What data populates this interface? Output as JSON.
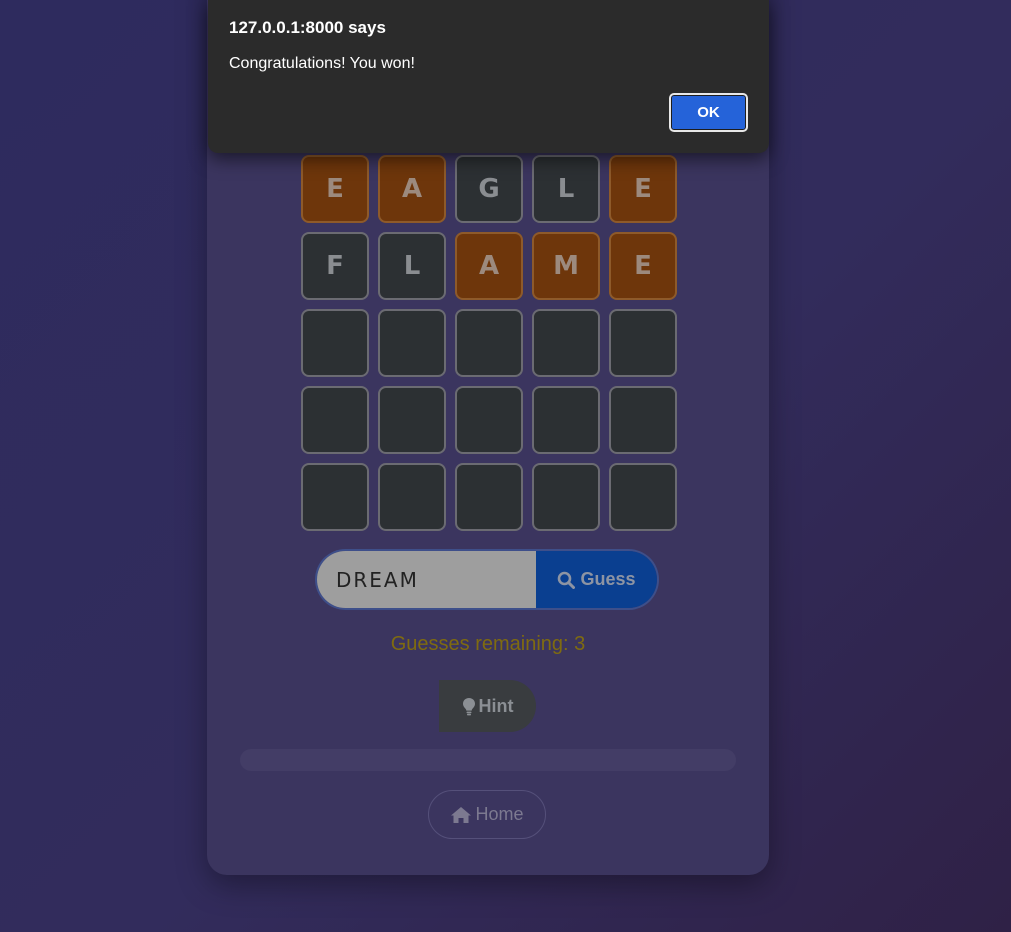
{
  "alert": {
    "title": "127.0.0.1:8000 says",
    "message": "Congratulations! You won!",
    "ok_label": "OK"
  },
  "board": {
    "rows": [
      {
        "cells": [
          {
            "letter": "E",
            "state": "present"
          },
          {
            "letter": "A",
            "state": "present"
          },
          {
            "letter": "G",
            "state": "absent"
          },
          {
            "letter": "L",
            "state": "absent"
          },
          {
            "letter": "E",
            "state": "present"
          }
        ]
      },
      {
        "cells": [
          {
            "letter": "F",
            "state": "absent"
          },
          {
            "letter": "L",
            "state": "absent"
          },
          {
            "letter": "A",
            "state": "present"
          },
          {
            "letter": "M",
            "state": "present"
          },
          {
            "letter": "E",
            "state": "present"
          }
        ]
      },
      {
        "cells": [
          {
            "letter": "",
            "state": "empty"
          },
          {
            "letter": "",
            "state": "empty"
          },
          {
            "letter": "",
            "state": "empty"
          },
          {
            "letter": "",
            "state": "empty"
          },
          {
            "letter": "",
            "state": "empty"
          }
        ]
      },
      {
        "cells": [
          {
            "letter": "",
            "state": "empty"
          },
          {
            "letter": "",
            "state": "empty"
          },
          {
            "letter": "",
            "state": "empty"
          },
          {
            "letter": "",
            "state": "empty"
          },
          {
            "letter": "",
            "state": "empty"
          }
        ]
      },
      {
        "cells": [
          {
            "letter": "",
            "state": "empty"
          },
          {
            "letter": "",
            "state": "empty"
          },
          {
            "letter": "",
            "state": "empty"
          },
          {
            "letter": "",
            "state": "empty"
          },
          {
            "letter": "",
            "state": "empty"
          }
        ]
      }
    ]
  },
  "guess": {
    "input_value": "DREAM",
    "button_label": "Guess"
  },
  "status": {
    "remaining_text": "Guesses remaining: 3"
  },
  "hint": {
    "label": "Hint"
  },
  "progress": {
    "fraction": 0
  },
  "home": {
    "label": "Home"
  },
  "colors": {
    "present": "#6e360b",
    "absent": "#2c3033",
    "guess_button": "#0a3f90",
    "remaining_text": "#7f6b10",
    "alert_ok": "#2563d9"
  },
  "icons": {
    "guess": "search-icon",
    "hint": "lightbulb-icon",
    "home": "home-icon"
  }
}
